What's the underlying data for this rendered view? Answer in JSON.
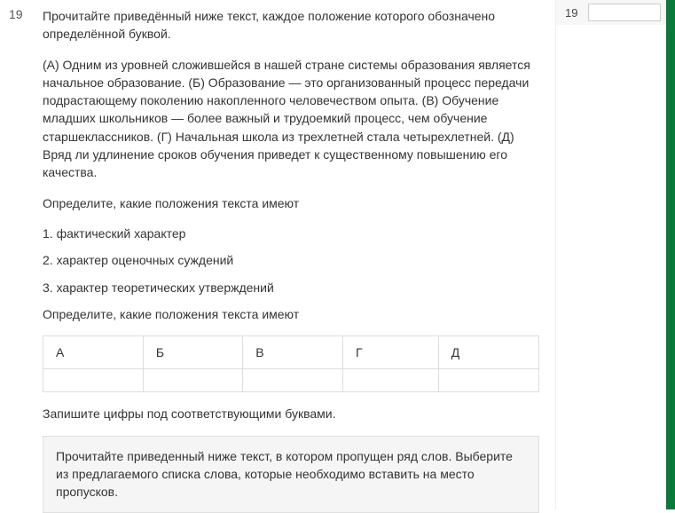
{
  "question": {
    "number": "19",
    "intro": "Прочитайте приведённый ниже текст, каждое положение которого обозначено определённой буквой.",
    "passage": "(А) Одним из уровней сложившейся в нашей стране системы образования является начальное образование. (Б) Образование — это организованный процесс передачи подрастающему поколению накопленного человечеством опыта. (В) Обучение младших школьников — более важный и трудоемкий процесс, чем обучение старшеклассников. (Г) Начальная школа из трехлетней стала четырехлетней. (Д) Вряд ли удлинение сроков обучения приведет к существенному повышению его качества.",
    "prompt1": "Определите, какие положения текста имеют",
    "options": [
      "1. фактический характер",
      "2. характер оценочных суждений",
      "3. характер теоретических утверждений"
    ],
    "prompt2": "Определите, какие положения текста имеют",
    "table_headers": [
      "А",
      "Б",
      "В",
      "Г",
      "Д"
    ],
    "footer": "Запишите цифры под соответствующими буквами.",
    "next_instruction": "Прочитайте приведенный ниже текст, в котором пропущен ряд слов. Выберите из предлагаемого списка слова, которые необходимо вставить на место пропусков."
  },
  "sidebar": {
    "number": "19",
    "value": ""
  }
}
